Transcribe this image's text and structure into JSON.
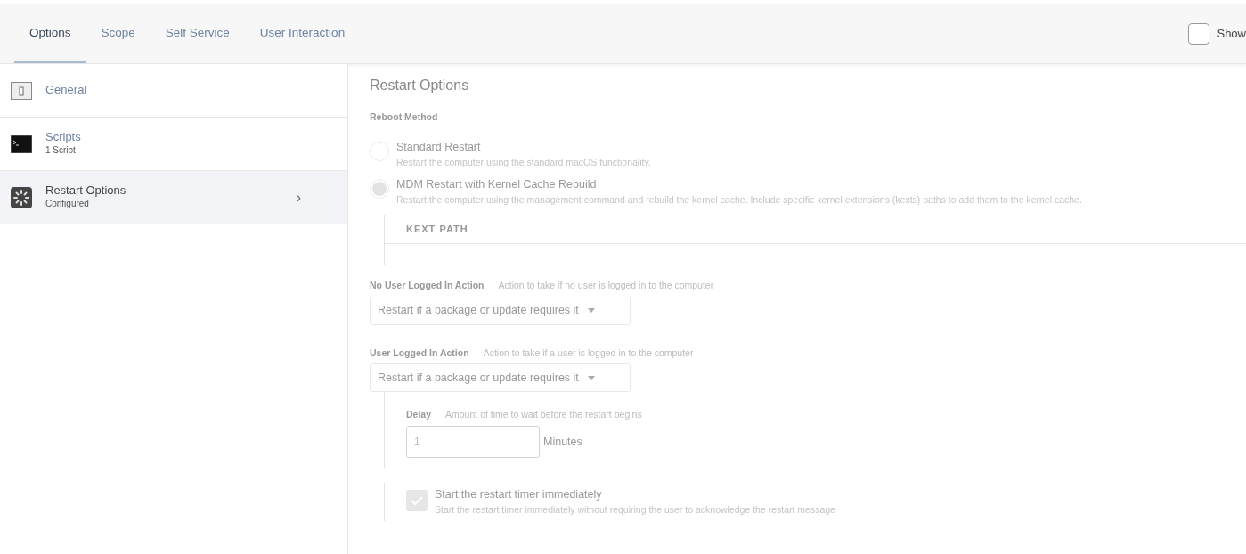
{
  "tabs": [
    {
      "label": "Options",
      "selected": true
    },
    {
      "label": "Scope",
      "selected": false
    },
    {
      "label": "Self Service",
      "selected": false
    },
    {
      "label": "User Interaction",
      "selected": false
    }
  ],
  "show_toggle": {
    "label": "Show",
    "checked": false
  },
  "sidebar": {
    "items": [
      {
        "kind": "general",
        "title": "General",
        "selected": false
      },
      {
        "kind": "scripts",
        "title": "Scripts",
        "subtitle": "1 Script",
        "selected": false
      },
      {
        "kind": "restart",
        "title": "Restart Options",
        "subtitle": "Configured",
        "selected": true,
        "chevron": "›"
      }
    ]
  },
  "panel": {
    "title": "Restart Options",
    "reboot_method": {
      "label": "Reboot Method",
      "options": [
        {
          "label": "Standard Restart",
          "description": "Restart the computer using the standard macOS functionality.",
          "selected": false
        },
        {
          "label": "MDM Restart with Kernel Cache Rebuild",
          "description": "Restart the computer using the management command and rebuild the kernel cache. Include specific kernel extensions (kexts) paths to add them to the kernel cache.",
          "selected": true
        }
      ]
    },
    "kext_table": {
      "columns": [
        "KEXT PATH"
      ]
    },
    "actions": [
      {
        "label": "No User Logged In Action",
        "hint": "Action to take if no user is logged in to the computer",
        "value": "Restart if a package or update requires it"
      },
      {
        "label": "User Logged In Action",
        "hint": "Action to take if a user is logged in to the computer",
        "value": "Restart if a package or update requires it"
      }
    ],
    "delay": {
      "label": "Delay",
      "hint": "Amount of time to wait before the restart begins",
      "value": "1",
      "unit": "Minutes"
    },
    "timer": {
      "label": "Start the restart timer immediately",
      "description": "Start the restart timer immediately without requiring the user to acknowledge the restart message",
      "checked": true
    }
  }
}
